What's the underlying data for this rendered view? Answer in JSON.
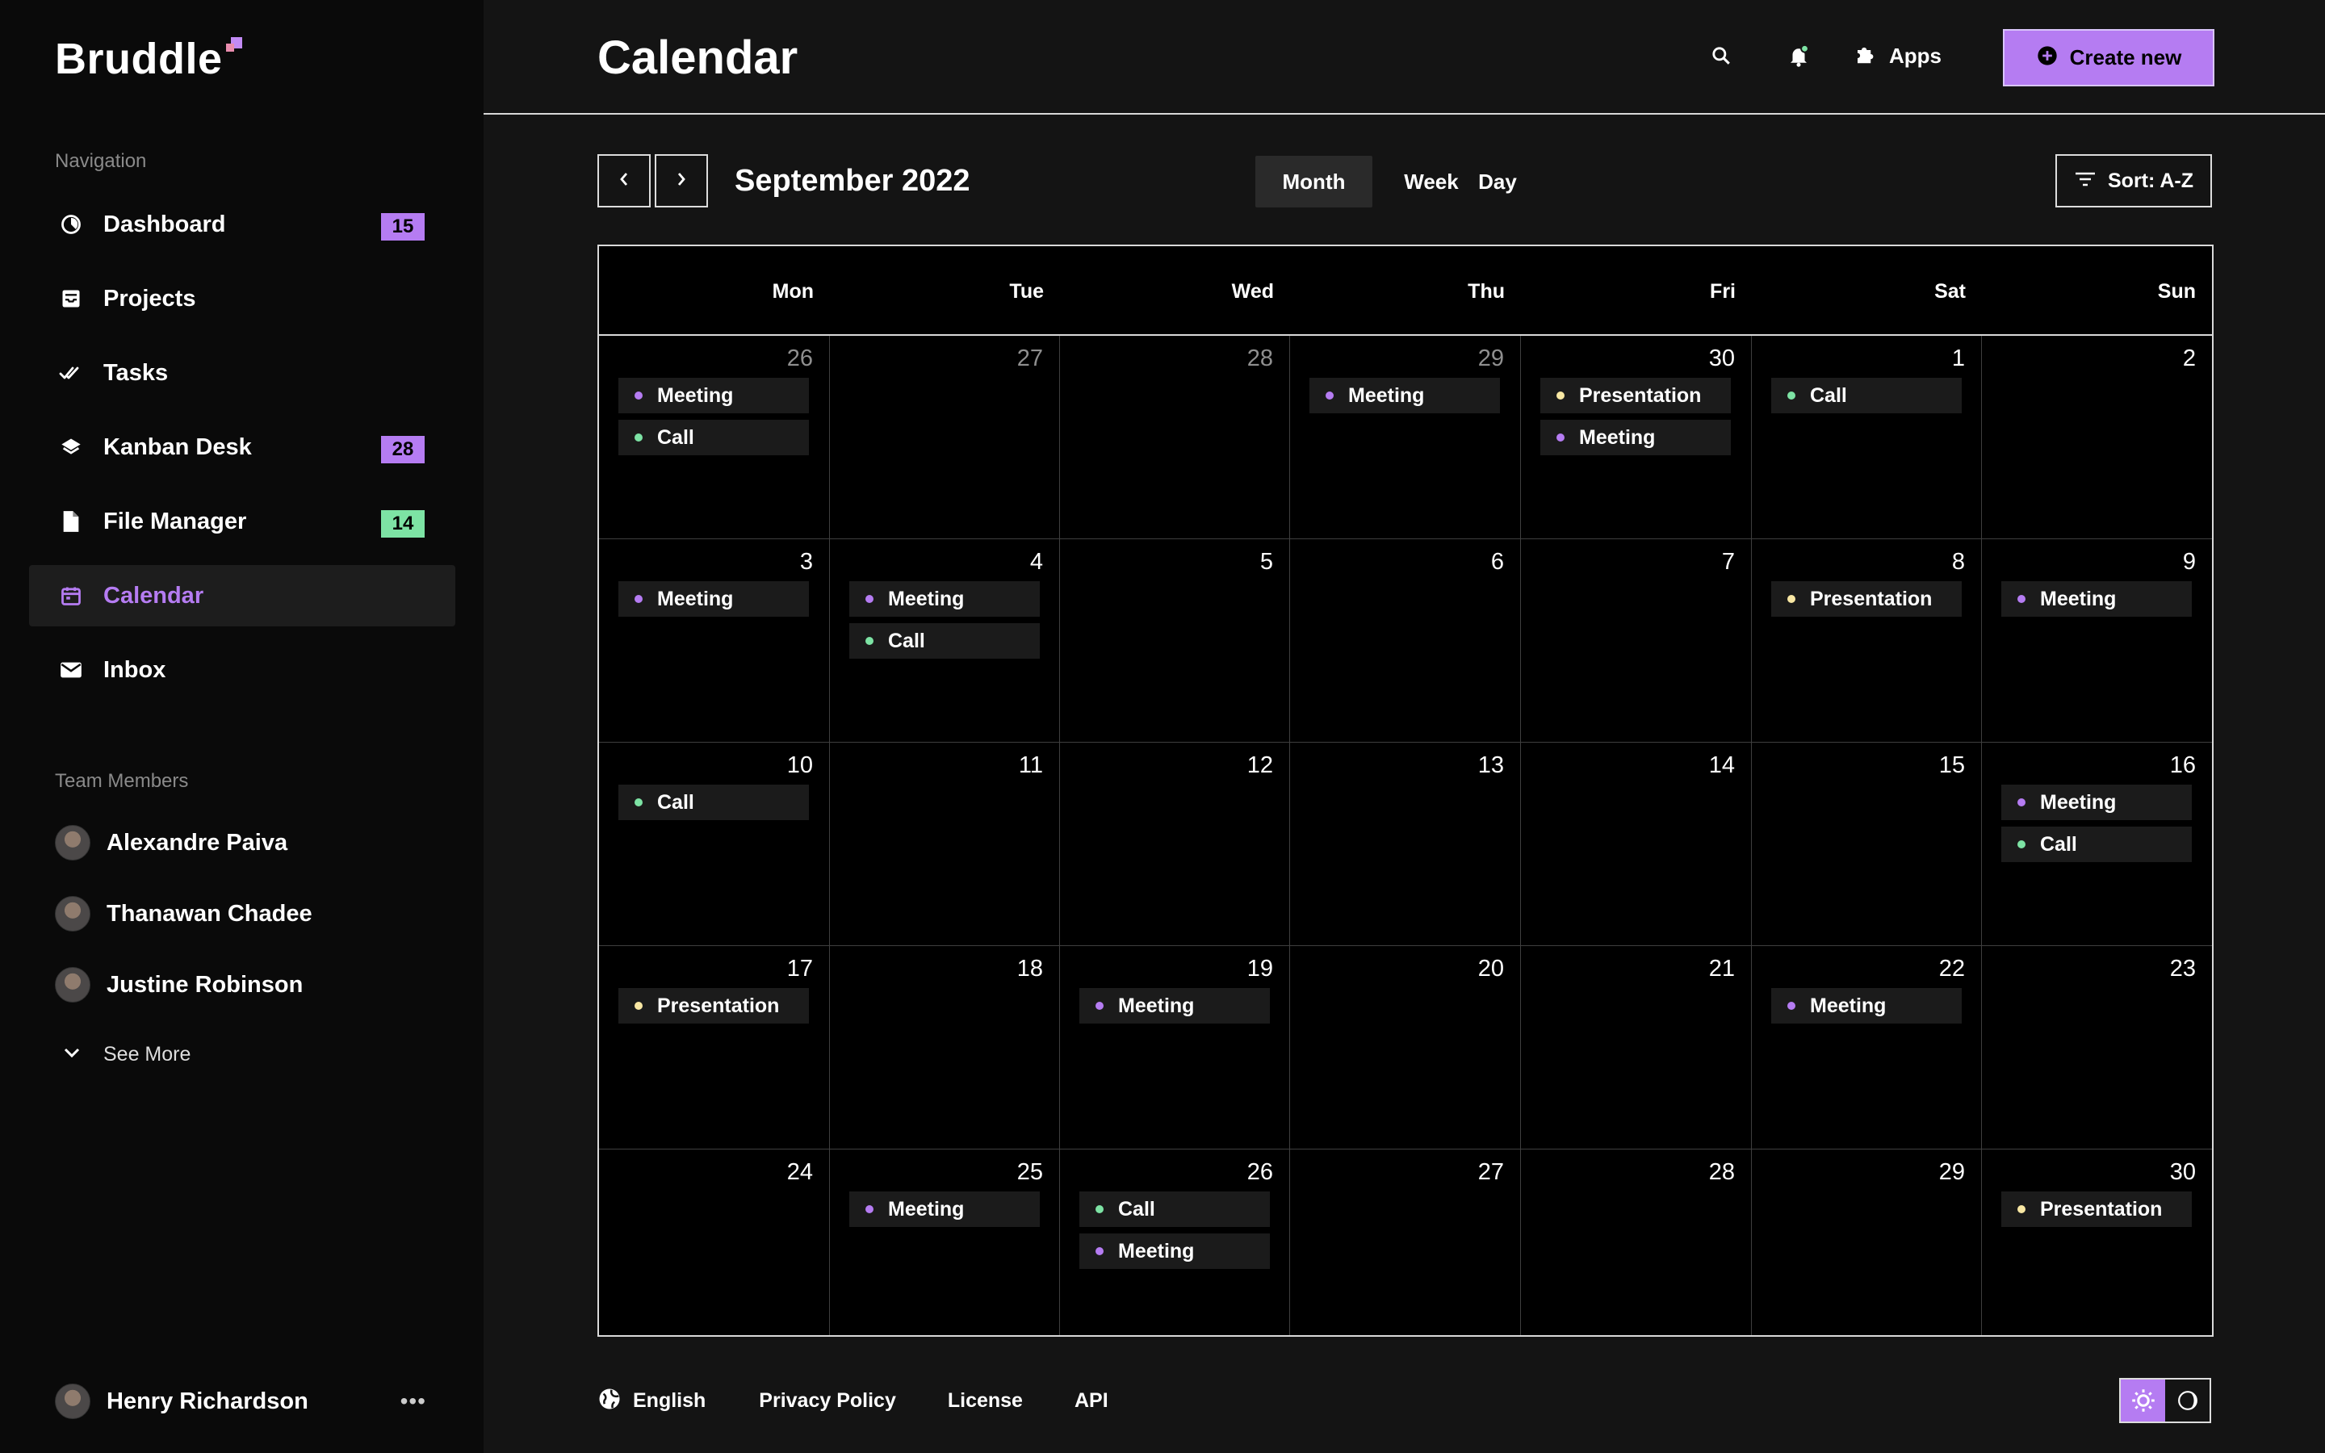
{
  "brand": {
    "name": "Bruddle"
  },
  "colors": {
    "accent": "#b57cf2",
    "green": "#7de3a4",
    "yellow": "#f8e7a3"
  },
  "sidebar": {
    "nav_title": "Navigation",
    "items": [
      {
        "label": "Dashboard",
        "icon": "dashboard-icon",
        "badge": "15",
        "badge_color": "purple"
      },
      {
        "label": "Projects",
        "icon": "inbox-tray-icon"
      },
      {
        "label": "Tasks",
        "icon": "double-check-icon"
      },
      {
        "label": "Kanban Desk",
        "icon": "layers-icon",
        "badge": "28",
        "badge_color": "purple"
      },
      {
        "label": "File Manager",
        "icon": "file-icon",
        "badge": "14",
        "badge_color": "green"
      },
      {
        "label": "Calendar",
        "icon": "calendar-icon",
        "active": true
      },
      {
        "label": "Inbox",
        "icon": "mail-icon"
      }
    ],
    "team_title": "Team Members",
    "members": [
      {
        "name": "Alexandre Paiva"
      },
      {
        "name": "Thanawan Chadee"
      },
      {
        "name": "Justine Robinson"
      }
    ],
    "see_more": "See More",
    "current_user": "Henry Richardson"
  },
  "header": {
    "title": "Calendar",
    "apps_label": "Apps",
    "create_label": "Create new"
  },
  "toolbar": {
    "month_label": "September 2022",
    "views": [
      "Month",
      "Week",
      "Day"
    ],
    "active_view": "Month",
    "sort_label": "Sort: A-Z"
  },
  "calendar": {
    "weekdays": [
      "Mon",
      "Tue",
      "Wed",
      "Thu",
      "Fri",
      "Sat",
      "Sun"
    ],
    "weeks": [
      [
        {
          "day": "26",
          "muted": true,
          "events": [
            {
              "label": "Meeting",
              "type": "meeting"
            },
            {
              "label": "Call",
              "type": "call"
            }
          ]
        },
        {
          "day": "27",
          "muted": true,
          "events": []
        },
        {
          "day": "28",
          "muted": true,
          "events": []
        },
        {
          "day": "29",
          "muted": true,
          "events": [
            {
              "label": "Meeting",
              "type": "meeting"
            }
          ]
        },
        {
          "day": "30",
          "muted": false,
          "events": [
            {
              "label": "Presentation",
              "type": "presentation"
            },
            {
              "label": "Meeting",
              "type": "meeting"
            }
          ]
        },
        {
          "day": "1",
          "muted": false,
          "events": [
            {
              "label": "Call",
              "type": "call"
            }
          ]
        },
        {
          "day": "2",
          "muted": false,
          "events": []
        }
      ],
      [
        {
          "day": "3",
          "events": [
            {
              "label": "Meeting",
              "type": "meeting"
            }
          ]
        },
        {
          "day": "4",
          "events": [
            {
              "label": "Meeting",
              "type": "meeting"
            },
            {
              "label": "Call",
              "type": "call"
            }
          ]
        },
        {
          "day": "5",
          "events": []
        },
        {
          "day": "6",
          "events": []
        },
        {
          "day": "7",
          "events": []
        },
        {
          "day": "8",
          "events": [
            {
              "label": "Presentation",
              "type": "presentation"
            }
          ]
        },
        {
          "day": "9",
          "events": [
            {
              "label": "Meeting",
              "type": "meeting"
            }
          ]
        }
      ],
      [
        {
          "day": "10",
          "events": [
            {
              "label": "Call",
              "type": "call"
            }
          ]
        },
        {
          "day": "11",
          "events": []
        },
        {
          "day": "12",
          "events": []
        },
        {
          "day": "13",
          "events": []
        },
        {
          "day": "14",
          "events": []
        },
        {
          "day": "15",
          "events": []
        },
        {
          "day": "16",
          "events": [
            {
              "label": "Meeting",
              "type": "meeting"
            },
            {
              "label": "Call",
              "type": "call"
            }
          ]
        }
      ],
      [
        {
          "day": "17",
          "events": [
            {
              "label": "Presentation",
              "type": "presentation"
            }
          ]
        },
        {
          "day": "18",
          "events": []
        },
        {
          "day": "19",
          "events": [
            {
              "label": "Meeting",
              "type": "meeting"
            }
          ]
        },
        {
          "day": "20",
          "events": []
        },
        {
          "day": "21",
          "events": []
        },
        {
          "day": "22",
          "events": [
            {
              "label": "Meeting",
              "type": "meeting"
            }
          ]
        },
        {
          "day": "23",
          "events": []
        }
      ],
      [
        {
          "day": "24",
          "events": []
        },
        {
          "day": "25",
          "events": [
            {
              "label": "Meeting",
              "type": "meeting"
            }
          ]
        },
        {
          "day": "26",
          "events": [
            {
              "label": "Call",
              "type": "call"
            },
            {
              "label": "Meeting",
              "type": "meeting"
            }
          ]
        },
        {
          "day": "27",
          "events": []
        },
        {
          "day": "28",
          "events": []
        },
        {
          "day": "29",
          "events": []
        },
        {
          "day": "30",
          "events": [
            {
              "label": "Presentation",
              "type": "presentation"
            }
          ]
        }
      ]
    ]
  },
  "footer": {
    "language": "English",
    "links": [
      "Privacy Policy",
      "License",
      "API"
    ]
  }
}
